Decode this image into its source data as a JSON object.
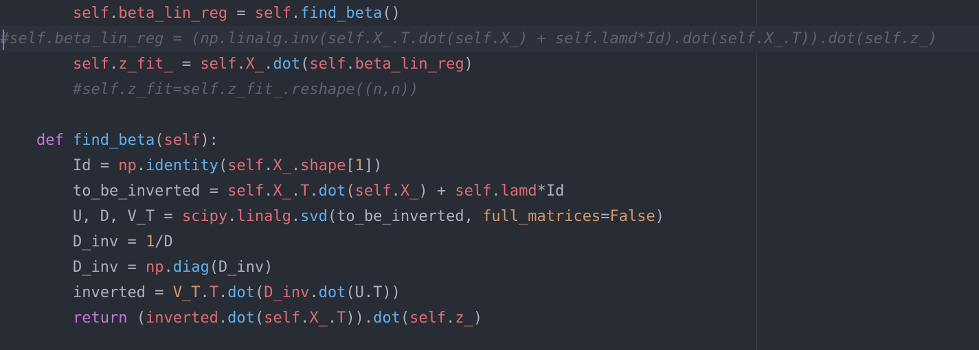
{
  "editor": {
    "theme_colors": {
      "background": "#282c34",
      "active_line": "#2c313c",
      "caret": "#528bff",
      "self": "#e06c75",
      "function": "#61afef",
      "keyword": "#c678dd",
      "number": "#d19a66",
      "comment": "#5c6370",
      "plain": "#abb2bf"
    },
    "lines": [
      {
        "tokens": [
          {
            "t": "        ",
            "c": "plain"
          },
          {
            "t": "self",
            "c": "self"
          },
          {
            "t": ".",
            "c": "plain"
          },
          {
            "t": "beta_lin_reg",
            "c": "self"
          },
          {
            "t": " = ",
            "c": "plain"
          },
          {
            "t": "self",
            "c": "self"
          },
          {
            "t": ".",
            "c": "plain"
          },
          {
            "t": "find_beta",
            "c": "fn"
          },
          {
            "t": "()",
            "c": "plain"
          }
        ]
      },
      {
        "tokens": [
          {
            "t": "#self.beta_lin_reg = (np.linalg.inv(self.X_.T.dot(self.X_) + self.lamd*Id).dot(self.X_.T)).dot(self.z_)",
            "c": "comment"
          }
        ]
      },
      {
        "tokens": [
          {
            "t": "        ",
            "c": "plain"
          },
          {
            "t": "self",
            "c": "self"
          },
          {
            "t": ".",
            "c": "plain"
          },
          {
            "t": "z_fit_",
            "c": "self"
          },
          {
            "t": " = ",
            "c": "plain"
          },
          {
            "t": "self",
            "c": "self"
          },
          {
            "t": ".",
            "c": "plain"
          },
          {
            "t": "X_",
            "c": "self"
          },
          {
            "t": ".",
            "c": "plain"
          },
          {
            "t": "dot",
            "c": "fn"
          },
          {
            "t": "(",
            "c": "plain"
          },
          {
            "t": "self",
            "c": "self"
          },
          {
            "t": ".",
            "c": "plain"
          },
          {
            "t": "beta_lin_reg",
            "c": "self"
          },
          {
            "t": ")",
            "c": "plain"
          }
        ]
      },
      {
        "tokens": [
          {
            "t": "        ",
            "c": "plain"
          },
          {
            "t": "#self.z_fit=self.z_fit_.reshape((n,n))",
            "c": "comment"
          }
        ]
      },
      {
        "tokens": [
          {
            "t": "",
            "c": "plain"
          }
        ]
      },
      {
        "tokens": [
          {
            "t": "    ",
            "c": "plain"
          },
          {
            "t": "def",
            "c": "kw"
          },
          {
            "t": " ",
            "c": "plain"
          },
          {
            "t": "find_beta",
            "c": "fn"
          },
          {
            "t": "(",
            "c": "plain"
          },
          {
            "t": "self",
            "c": "self"
          },
          {
            "t": "):",
            "c": "plain"
          }
        ]
      },
      {
        "tokens": [
          {
            "t": "        ",
            "c": "plain"
          },
          {
            "t": "Id",
            "c": "plain"
          },
          {
            "t": " = ",
            "c": "plain"
          },
          {
            "t": "np",
            "c": "self"
          },
          {
            "t": ".",
            "c": "plain"
          },
          {
            "t": "identity",
            "c": "fn"
          },
          {
            "t": "(",
            "c": "plain"
          },
          {
            "t": "self",
            "c": "self"
          },
          {
            "t": ".",
            "c": "plain"
          },
          {
            "t": "X_",
            "c": "self"
          },
          {
            "t": ".",
            "c": "plain"
          },
          {
            "t": "shape",
            "c": "self"
          },
          {
            "t": "[",
            "c": "plain"
          },
          {
            "t": "1",
            "c": "num"
          },
          {
            "t": "])",
            "c": "plain"
          }
        ]
      },
      {
        "tokens": [
          {
            "t": "        ",
            "c": "plain"
          },
          {
            "t": "to_be_inverted",
            "c": "plain"
          },
          {
            "t": " = ",
            "c": "plain"
          },
          {
            "t": "self",
            "c": "self"
          },
          {
            "t": ".",
            "c": "plain"
          },
          {
            "t": "X_",
            "c": "self"
          },
          {
            "t": ".",
            "c": "plain"
          },
          {
            "t": "T",
            "c": "self"
          },
          {
            "t": ".",
            "c": "plain"
          },
          {
            "t": "dot",
            "c": "fn"
          },
          {
            "t": "(",
            "c": "plain"
          },
          {
            "t": "self",
            "c": "self"
          },
          {
            "t": ".",
            "c": "plain"
          },
          {
            "t": "X_",
            "c": "self"
          },
          {
            "t": ") + ",
            "c": "plain"
          },
          {
            "t": "self",
            "c": "self"
          },
          {
            "t": ".",
            "c": "plain"
          },
          {
            "t": "lamd",
            "c": "self"
          },
          {
            "t": "*Id",
            "c": "plain"
          }
        ]
      },
      {
        "tokens": [
          {
            "t": "        ",
            "c": "plain"
          },
          {
            "t": "U, D, V_T",
            "c": "plain"
          },
          {
            "t": " = ",
            "c": "plain"
          },
          {
            "t": "scipy",
            "c": "self"
          },
          {
            "t": ".",
            "c": "plain"
          },
          {
            "t": "linalg",
            "c": "self"
          },
          {
            "t": ".",
            "c": "plain"
          },
          {
            "t": "svd",
            "c": "fn"
          },
          {
            "t": "(to_be_inverted, ",
            "c": "plain"
          },
          {
            "t": "full_matrices",
            "c": "num"
          },
          {
            "t": "=",
            "c": "plain"
          },
          {
            "t": "False",
            "c": "num"
          },
          {
            "t": ")",
            "c": "plain"
          }
        ]
      },
      {
        "tokens": [
          {
            "t": "        ",
            "c": "plain"
          },
          {
            "t": "D_inv",
            "c": "plain"
          },
          {
            "t": " = ",
            "c": "plain"
          },
          {
            "t": "1",
            "c": "num"
          },
          {
            "t": "/D",
            "c": "plain"
          }
        ]
      },
      {
        "tokens": [
          {
            "t": "        ",
            "c": "plain"
          },
          {
            "t": "D_inv",
            "c": "plain"
          },
          {
            "t": " = ",
            "c": "plain"
          },
          {
            "t": "np",
            "c": "self"
          },
          {
            "t": ".",
            "c": "plain"
          },
          {
            "t": "diag",
            "c": "fn"
          },
          {
            "t": "(D_inv)",
            "c": "plain"
          }
        ]
      },
      {
        "tokens": [
          {
            "t": "        ",
            "c": "plain"
          },
          {
            "t": "inverted",
            "c": "plain"
          },
          {
            "t": " = ",
            "c": "plain"
          },
          {
            "t": "V_T",
            "c": "num"
          },
          {
            "t": ".",
            "c": "plain"
          },
          {
            "t": "T",
            "c": "self"
          },
          {
            "t": ".",
            "c": "plain"
          },
          {
            "t": "dot",
            "c": "fn"
          },
          {
            "t": "(",
            "c": "plain"
          },
          {
            "t": "D_inv",
            "c": "self"
          },
          {
            "t": ".",
            "c": "plain"
          },
          {
            "t": "dot",
            "c": "fn"
          },
          {
            "t": "(U.T))",
            "c": "plain"
          }
        ]
      },
      {
        "tokens": [
          {
            "t": "        ",
            "c": "plain"
          },
          {
            "t": "return",
            "c": "kw"
          },
          {
            "t": " (",
            "c": "plain"
          },
          {
            "t": "inverted",
            "c": "self"
          },
          {
            "t": ".",
            "c": "plain"
          },
          {
            "t": "dot",
            "c": "fn"
          },
          {
            "t": "(",
            "c": "plain"
          },
          {
            "t": "self",
            "c": "self"
          },
          {
            "t": ".",
            "c": "plain"
          },
          {
            "t": "X_",
            "c": "self"
          },
          {
            "t": ".",
            "c": "plain"
          },
          {
            "t": "T",
            "c": "self"
          },
          {
            "t": ")).",
            "c": "plain"
          },
          {
            "t": "dot",
            "c": "fn"
          },
          {
            "t": "(",
            "c": "plain"
          },
          {
            "t": "self",
            "c": "self"
          },
          {
            "t": ".",
            "c": "plain"
          },
          {
            "t": "z_",
            "c": "self"
          },
          {
            "t": ")",
            "c": "plain"
          }
        ]
      }
    ],
    "active_line_index": 1
  }
}
